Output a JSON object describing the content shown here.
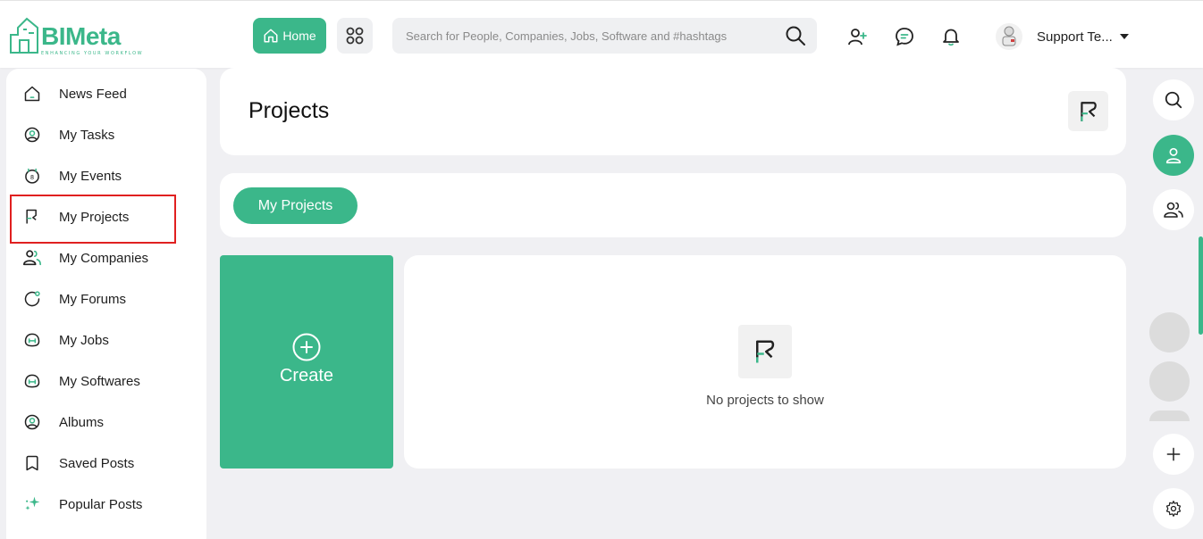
{
  "header": {
    "logo_text": "BIMeta",
    "logo_tagline": "ENHANCING YOUR WORKFLOW",
    "home_label": "Home",
    "search_placeholder": "Search for People, Companies, Jobs, Software and #hashtags",
    "user_name": "Support Te...",
    "icons": [
      "home-icon",
      "apps-icon",
      "search-icon",
      "add-user-icon",
      "chat-icon",
      "bell-icon"
    ]
  },
  "sidebar": {
    "items": [
      {
        "label": "News Feed",
        "icon": "home-icon"
      },
      {
        "label": "My Tasks",
        "icon": "tasks-icon"
      },
      {
        "label": "My Events",
        "icon": "calendar-icon"
      },
      {
        "label": "My Projects",
        "icon": "flag-icon"
      },
      {
        "label": "My Companies",
        "icon": "companies-icon"
      },
      {
        "label": "My Forums",
        "icon": "forums-icon"
      },
      {
        "label": "My Jobs",
        "icon": "jobs-icon"
      },
      {
        "label": "My Softwares",
        "icon": "softwares-icon"
      },
      {
        "label": "Albums",
        "icon": "albums-icon"
      },
      {
        "label": "Saved Posts",
        "icon": "bookmark-icon"
      },
      {
        "label": "Popular Posts",
        "icon": "sparkle-icon"
      }
    ],
    "selected": "My Projects"
  },
  "main": {
    "page_title": "Projects",
    "tabs": [
      {
        "label": "My Projects"
      }
    ],
    "create_label": "Create",
    "empty_text": "No projects to show"
  },
  "right_rail": {
    "icons": [
      "search-icon",
      "user-icon",
      "users-icon",
      "plus-icon",
      "gear-icon"
    ]
  },
  "colors": {
    "accent": "#3bb78a",
    "highlight_border": "#e02020",
    "background": "#f0f0f3"
  }
}
